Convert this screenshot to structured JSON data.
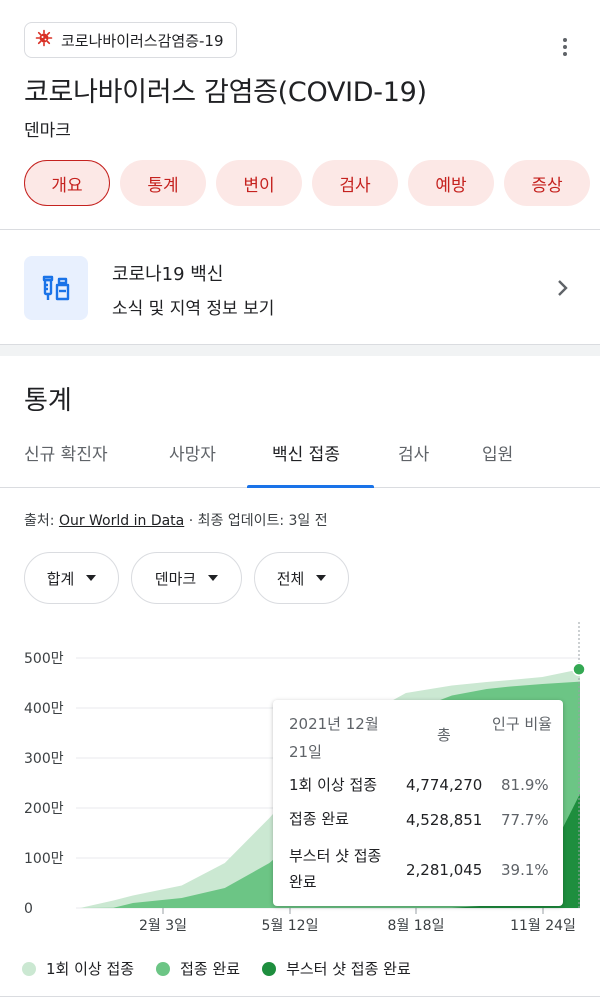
{
  "topic_chip": {
    "label": "코로나바이러스감염증-19",
    "icon": "virus-icon"
  },
  "header": {
    "title": "코로나바이러스 감염증(COVID-19)",
    "subtitle": "덴마크"
  },
  "pills": [
    {
      "label": "개요",
      "active": true
    },
    {
      "label": "통계"
    },
    {
      "label": "변이"
    },
    {
      "label": "검사"
    },
    {
      "label": "예방"
    },
    {
      "label": "증상"
    }
  ],
  "vaccine_card": {
    "title": "코로나19 백신",
    "subtitle": "소식 및 지역 정보 보기",
    "icon": "vaccine-icon"
  },
  "stats": {
    "title": "통계",
    "tabs": [
      "신규 확진자",
      "사망자",
      "백신 접종",
      "검사",
      "입원"
    ],
    "active_tab": "백신 접종",
    "source_prefix": "출처:",
    "source_link": "Our World in Data",
    "source_suffix": "· 최종 업데이트: 3일 전",
    "dropdowns": [
      "합계",
      "덴마크",
      "전체"
    ]
  },
  "chart_data": {
    "type": "area",
    "ylabels": [
      "500만",
      "400만",
      "300만",
      "200만",
      "100만",
      "0"
    ],
    "xlabels": [
      "2월 3일",
      "5월 12일",
      "8월 18일",
      "11월 24일"
    ],
    "ylim": [
      0,
      5000000
    ],
    "x": [
      "2020-12-27",
      "2021-01-20",
      "2021-02-03",
      "2021-03-10",
      "2021-04-10",
      "2021-05-12",
      "2021-06-10",
      "2021-07-10",
      "2021-08-18",
      "2021-09-20",
      "2021-10-15",
      "2021-11-01",
      "2021-11-24",
      "2021-12-21"
    ],
    "series": [
      {
        "name": "1회 이상 접종",
        "color": "#cbe8d2",
        "values": [
          0,
          150000,
          250000,
          450000,
          900000,
          1800000,
          2700000,
          3700000,
          4300000,
          4450000,
          4520000,
          4560000,
          4620000,
          4774270
        ]
      },
      {
        "name": "접종 완료",
        "color": "#6cc585",
        "values": [
          0,
          5000,
          100000,
          200000,
          400000,
          900000,
          1600000,
          2600000,
          3900000,
          4250000,
          4380000,
          4430000,
          4480000,
          4528851
        ]
      },
      {
        "name": "부스터 샷 접종 완료",
        "color": "#1e8e3e",
        "values": [
          0,
          0,
          0,
          0,
          0,
          0,
          0,
          0,
          0,
          0,
          50000,
          250000,
          800000,
          2281045
        ]
      }
    ]
  },
  "tooltip": {
    "date": "2021년 12월 21일",
    "col_total": "총",
    "col_ratio": "인구 비율",
    "rows": [
      {
        "label": "1회 이상 접종",
        "total": "4,774,270",
        "ratio": "81.9%"
      },
      {
        "label": "접종 완료",
        "total": "4,528,851",
        "ratio": "77.7%"
      },
      {
        "label": "부스터 샷 접종 완료",
        "total": "2,281,045",
        "ratio": "39.1%"
      }
    ]
  },
  "legend": [
    {
      "label": "1회 이상 접종",
      "color": "#cbe8d2"
    },
    {
      "label": "접종 완료",
      "color": "#6cc585"
    },
    {
      "label": "부스터 샷 접종 완료",
      "color": "#1e8e3e"
    }
  ]
}
